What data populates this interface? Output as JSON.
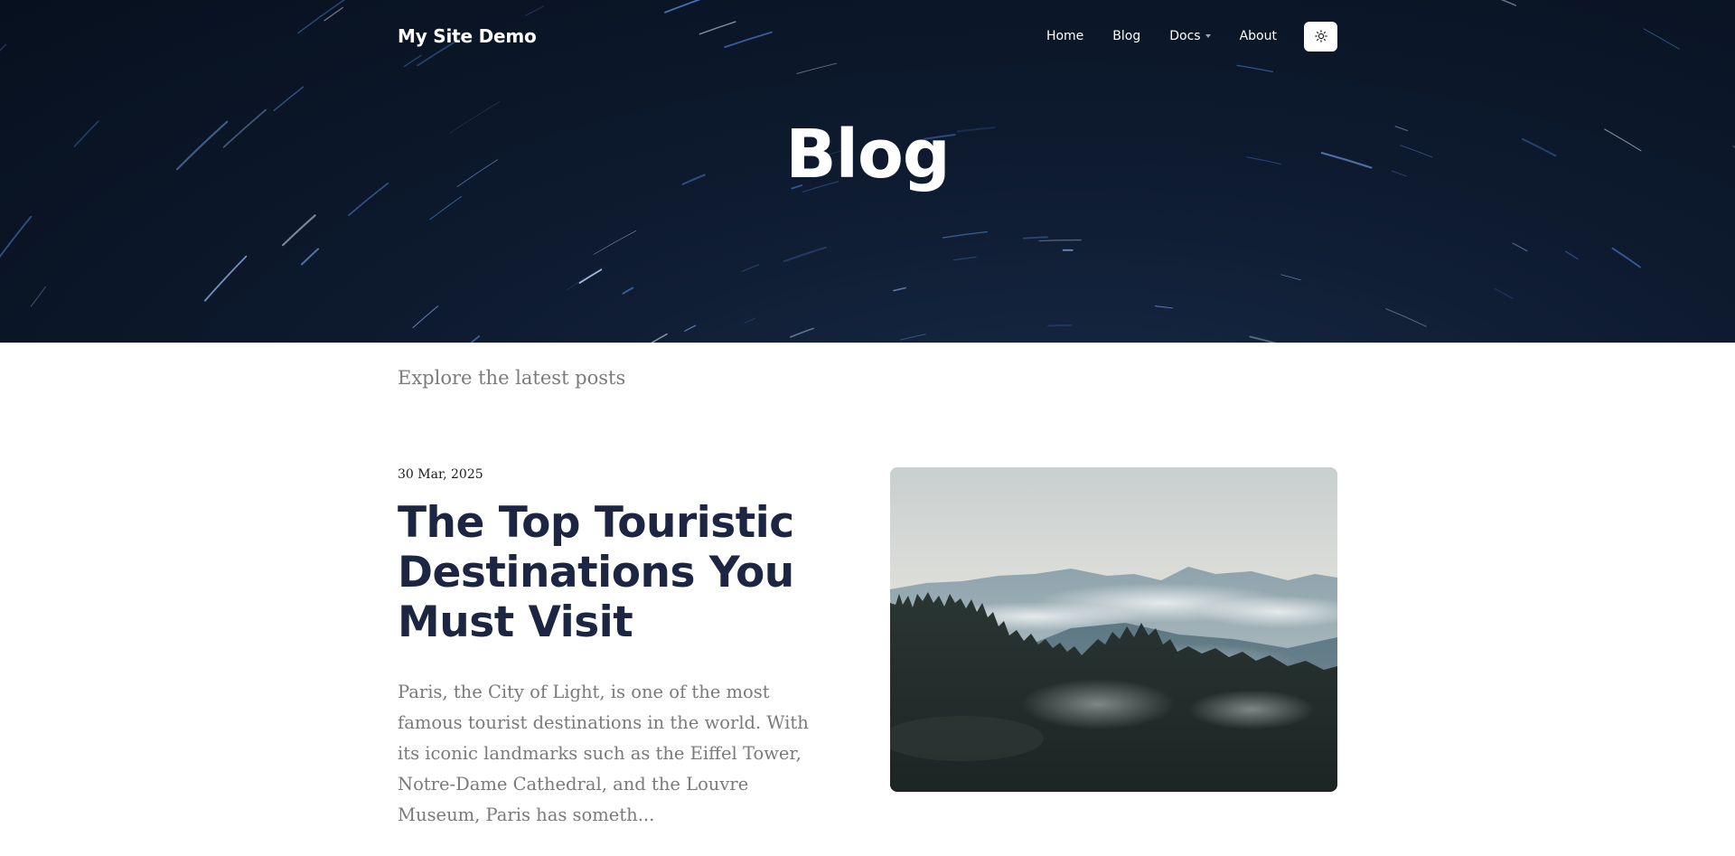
{
  "header": {
    "brand": "My Site Demo",
    "nav": [
      {
        "label": "Home"
      },
      {
        "label": "Blog"
      },
      {
        "label": "Docs",
        "has_dropdown": true
      },
      {
        "label": "About"
      }
    ],
    "theme_toggle_icon": "sun-icon"
  },
  "hero": {
    "title": "Blog"
  },
  "page": {
    "subtitle": "Explore the latest posts"
  },
  "posts": [
    {
      "date": "30 Mar, 2025",
      "title": "The Top Touristic Destinations You Must Visit",
      "excerpt": "Paris, the City of Light, is one of the most famous tourist destinations in the world. With its iconic landmarks such as the Eiffel Tower, Notre-Dame Cathedral, and the Louvre Museum, Paris has someth...",
      "image_icon": "misty-forest-mountains-image"
    }
  ],
  "colors": {
    "hero_bg": "#0b1626",
    "title_dark": "#1c2541",
    "muted_text": "#7a7a7a",
    "star_trail": "#5a86d6"
  }
}
